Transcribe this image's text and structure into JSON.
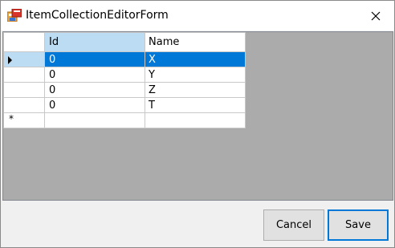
{
  "window": {
    "title": "ItemCollectionEditorForm",
    "close_glyph": "✕"
  },
  "grid": {
    "columns": [
      "Id",
      "Name"
    ],
    "rows": [
      {
        "id": "0",
        "name": "X",
        "selected": true
      },
      {
        "id": "0",
        "name": "Y",
        "selected": false
      },
      {
        "id": "0",
        "name": "Z",
        "selected": false
      },
      {
        "id": "0",
        "name": "T",
        "selected": false
      }
    ],
    "new_row_marker": "*",
    "selection_color": "#0078d7",
    "header_highlight_color": "#bcdcf4"
  },
  "buttons": {
    "cancel_label": "Cancel",
    "save_label": "Save"
  }
}
